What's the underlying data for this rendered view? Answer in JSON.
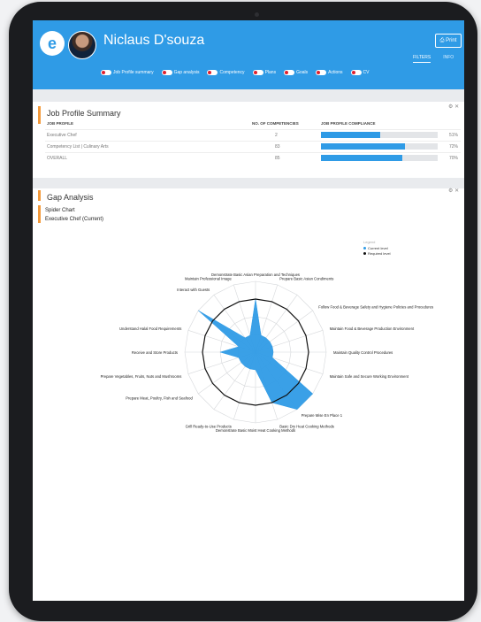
{
  "header": {
    "name": "Niclaus D'souza",
    "print_label": "Print",
    "tabs": [
      "FILTERS",
      "INFO"
    ]
  },
  "toggles": [
    "Job Profile summary",
    "Gap analysis",
    "Competency",
    "Plans",
    "Goals",
    "Actions",
    "CV"
  ],
  "job_profile": {
    "title": "Job Profile Summary",
    "columns": [
      "JOB PROFILE",
      "NO. OF COMPETENCIES",
      "JOB PROFILE COMPLIANCE"
    ],
    "rows": [
      {
        "profile": "Executive Chef",
        "count": "2",
        "compliance": 51,
        "pct": "51%"
      },
      {
        "profile": "Competency List | Culinary Arts",
        "count": "83",
        "compliance": 72,
        "pct": "72%"
      },
      {
        "profile": "OVERALL",
        "count": "85",
        "compliance": 70,
        "pct": "70%"
      }
    ]
  },
  "gap": {
    "title": "Gap Analysis",
    "subtitle": "Spider Chart",
    "profile": "Executive Chef (Current)"
  },
  "chart_data": {
    "type": "radar",
    "legend_title": "Legend",
    "series": [
      {
        "name": "Current level",
        "color": "#2f9be6",
        "values": [
          3,
          1,
          1,
          1,
          1,
          1,
          1,
          4,
          4,
          3,
          1,
          1,
          1,
          1,
          1,
          2,
          1,
          4,
          1,
          1
        ]
      },
      {
        "name": "Required level",
        "color": "#111111",
        "values": [
          3,
          3,
          3,
          3,
          3,
          3,
          3,
          3,
          3,
          3,
          3,
          3,
          3,
          3,
          3,
          3,
          3,
          3,
          3,
          3
        ]
      }
    ],
    "categories": [
      "Demonstrate Basic Asian Preparation and Techniques",
      "Prepare Basic Asian Condiments",
      "Follow Food & Beverage Safety and Hygiene Policies and Procedures",
      "Maintain Food & Beverage Production Environment",
      "Maintain Quality Control Procedures",
      "Maintain Safe and Secure Working Environment",
      "Prepare Mise En Place 1",
      "Basic Dry Heat Cooking Methods",
      "Demonstrate Basic Moist Heat Cooking Methods",
      "Grill Ready-to-Use Products",
      "Prepare Meat, Poultry, Fish and Seafood",
      "Prepare Vegetables, Fruits, Nuts and Mushrooms",
      "Receive and Store Products",
      "Understand Halal Food Requirements",
      "Interact with Guests",
      "Maintain Professional Image"
    ],
    "max": 4
  }
}
